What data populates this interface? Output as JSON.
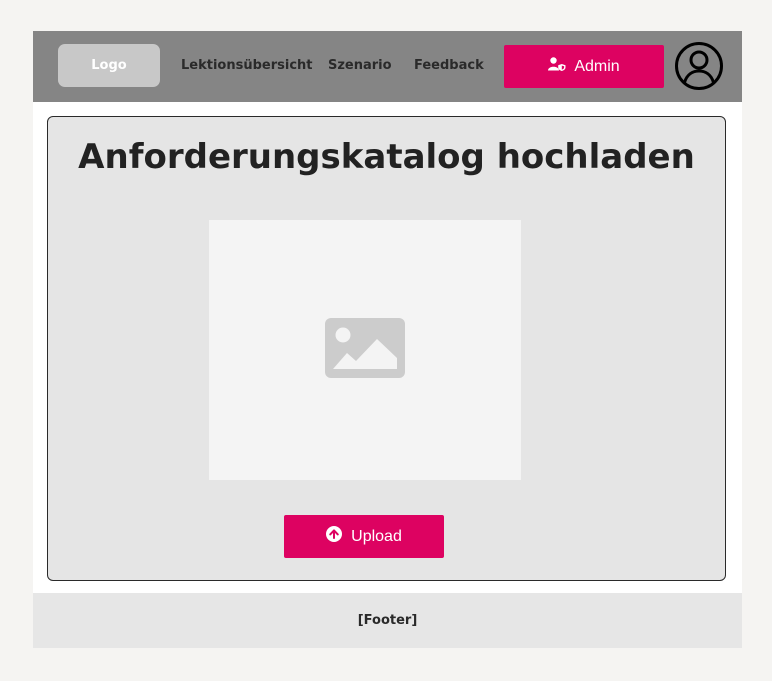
{
  "navbar": {
    "logo_label": "Logo",
    "links": [
      {
        "label": "Lektionsübersicht"
      },
      {
        "label": "Szenario"
      },
      {
        "label": "Feedback"
      }
    ],
    "admin_button": {
      "label": "Admin",
      "icon": "user-shield-icon"
    },
    "avatar_icon": "user-circle-icon"
  },
  "main": {
    "title": "Anforderungskatalog hochladen",
    "image_placeholder_icon": "image-icon",
    "upload_button": {
      "label": "Upload",
      "icon": "arrow-up-circle-icon"
    }
  },
  "footer": {
    "label": "[Footer]"
  },
  "colors": {
    "accent": "#dd0261",
    "navbar_bg": "#858585",
    "card_bg": "#e5e5e5"
  }
}
